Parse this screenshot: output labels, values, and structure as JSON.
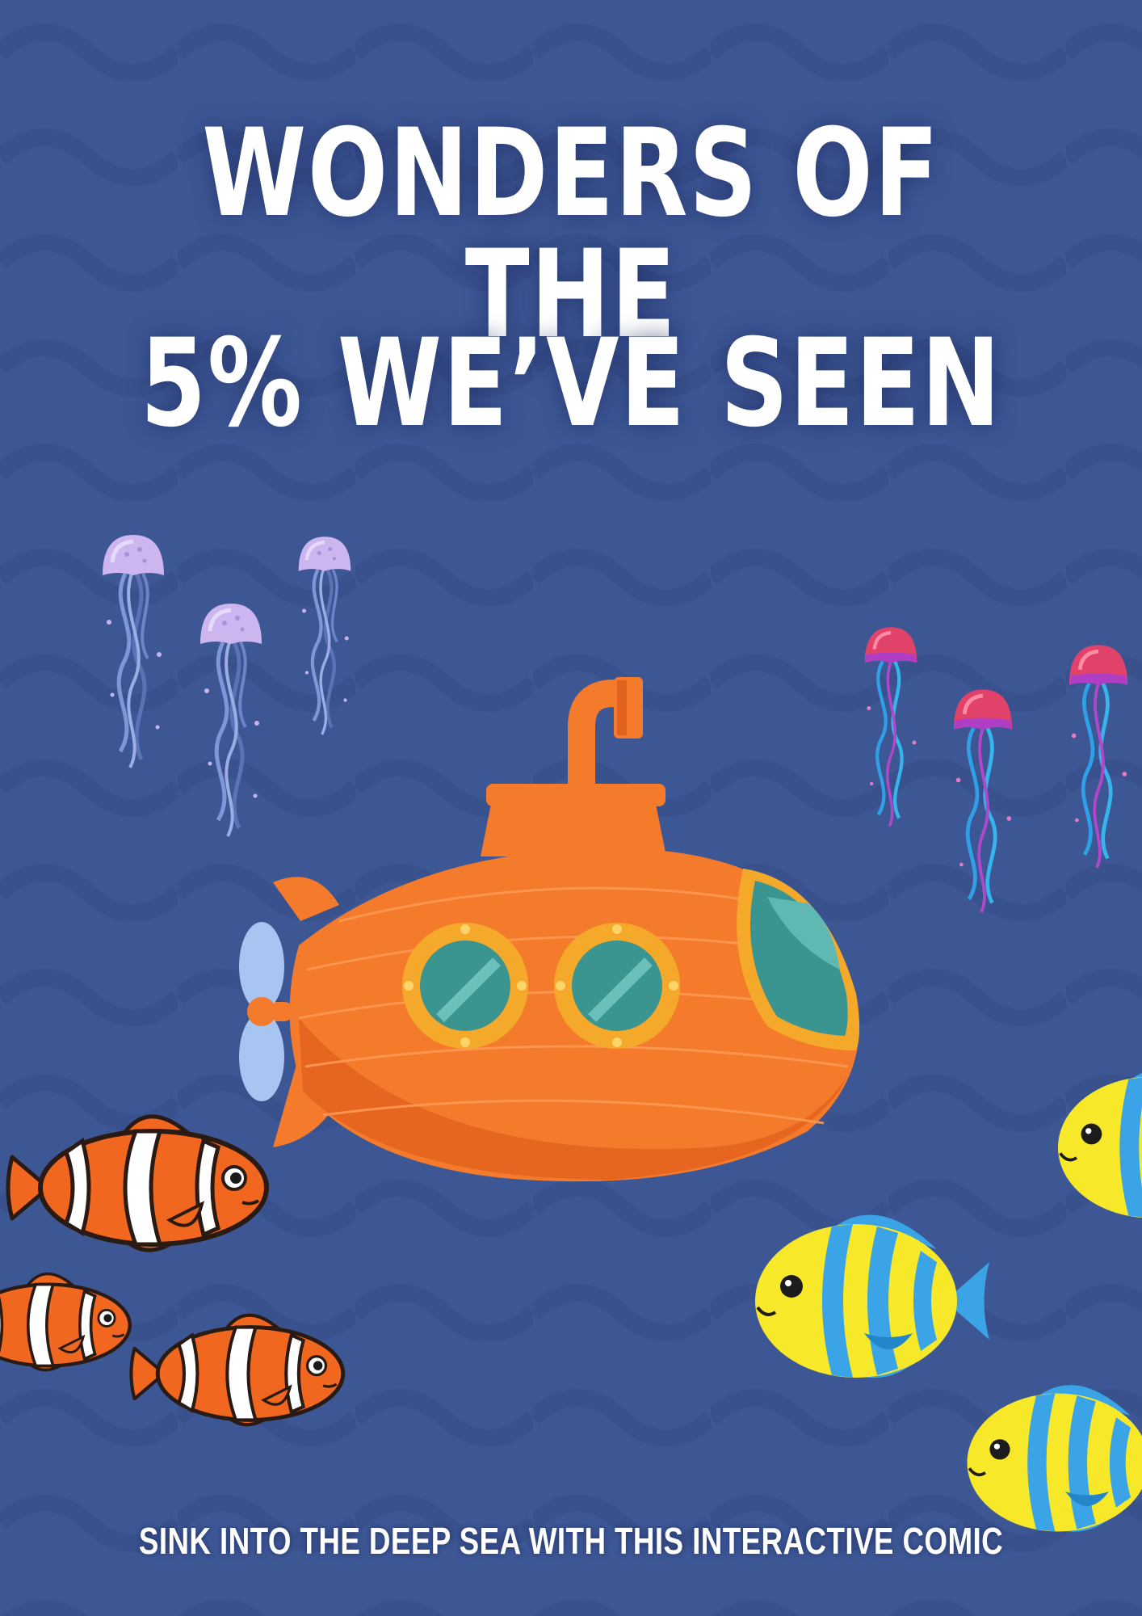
{
  "poster": {
    "title_line_1": "WONDERS OF THE",
    "title_line_2": "5% WE’VE SEEN",
    "tagline": "SINK INTO THE DEEP SEA WITH THIS INTERACTIVE COMIC"
  },
  "colors": {
    "background": "#3d5795",
    "wave": "#39508c",
    "text": "#ffffff",
    "submarine": "#f47a2c",
    "porthole": "#3a948f",
    "clownfish": "#f2671f",
    "tropical_fish_yellow": "#f7e829",
    "tropical_fish_blue": "#3aa4e6",
    "jellyfish_lavender": "#cdb6ef",
    "jellyfish_red": "#e0426a"
  },
  "illustrations": [
    "submarine-illustration",
    "clownfish-illustration",
    "tropical-fish-illustration",
    "jellyfish-illustration"
  ]
}
